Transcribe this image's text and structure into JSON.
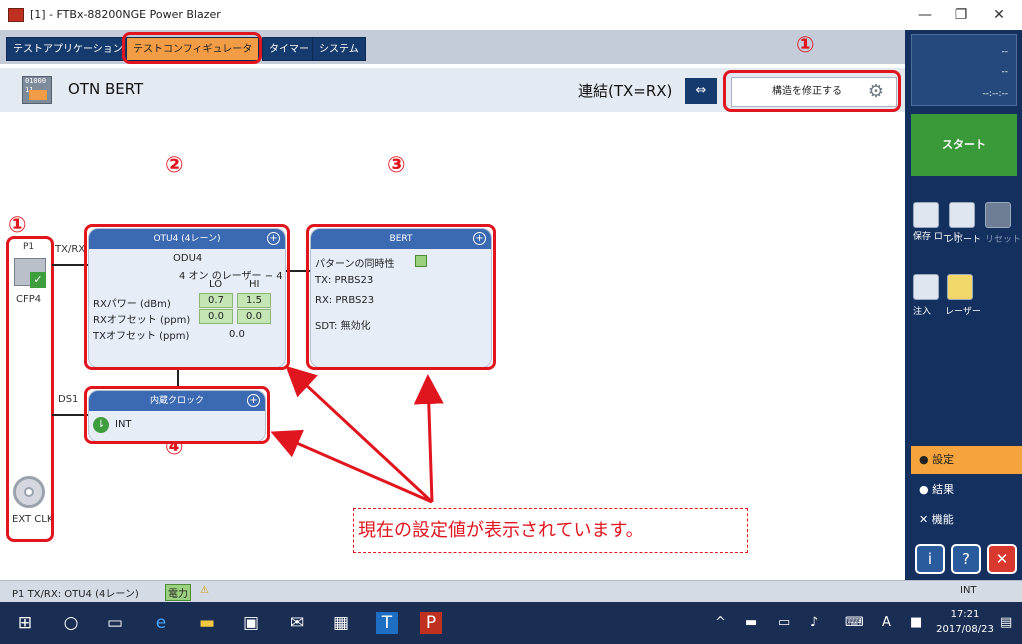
{
  "window": {
    "title": "[1] - FTBx-88200NGE Power Blazer",
    "minimize": "—",
    "maximize": "❐",
    "close": "✕"
  },
  "tabs": [
    {
      "label": "テストアプリケーション"
    },
    {
      "label": "テストコンフィギュレータ",
      "active": true
    },
    {
      "label": "タイマー"
    },
    {
      "label": "システム"
    }
  ],
  "header": {
    "icon_text": "01000\n1100",
    "title": "OTN BERT",
    "coupling_label": "連結(TX=RX)",
    "modify_button": "構造を修正する"
  },
  "annotations": {
    "one": "①",
    "two": "②",
    "three": "③",
    "four": "④",
    "callout": "現在の設定値が表示されています。"
  },
  "ports": {
    "p1": "P1",
    "txrx": "TX/RX",
    "cfp": "CFP4",
    "ds1": "DS1",
    "ext_clk": "EXT CLK"
  },
  "otu_block": {
    "header": "OTU4 (4レーン)",
    "odu": "ODU4",
    "lanes": "4 オン のレーザー − 4",
    "lo": "LO",
    "hi": "HI",
    "rx_power_label": "RXパワー (dBm)",
    "rx_power_lo": "0.7",
    "rx_power_hi": "1.5",
    "rx_offset_label": "RXオフセット (ppm)",
    "rx_offset_lo": "0.0",
    "rx_offset_hi": "0.0",
    "tx_offset_label": "TXオフセット (ppm)",
    "tx_offset": "0.0"
  },
  "bert_block": {
    "header": "BERT",
    "pattern_sync": "パターンの同時性",
    "tx": "TX: PRBS23",
    "rx": "RX: PRBS23",
    "sdt": "SDT: 無効化"
  },
  "clock_block": {
    "header": "内蔵クロック",
    "value": "INT"
  },
  "right_panel": {
    "status_top": "--",
    "status_mid": "--",
    "status_time": "--:--:--",
    "start": "スタート",
    "tools": {
      "save_load": "保存\nロード",
      "report": "レポート",
      "reset": "リセット",
      "inject": "注入",
      "laser": "レーザー"
    },
    "menu": [
      {
        "label": "設定",
        "active": true
      },
      {
        "label": "結果"
      },
      {
        "label": "機能"
      }
    ]
  },
  "status_bar": {
    "text": "P1 TX/RX: OTU4 (4レーン)",
    "power": "電力",
    "right": "INT"
  },
  "taskbar": {
    "time": "17:21",
    "date": "2017/08/23",
    "ime": "A"
  },
  "colors": {
    "accent_red": "#e0151e",
    "tab_active": "#f29c45",
    "block_header": "#3b6ab3",
    "start_green": "#3a9a3a"
  }
}
